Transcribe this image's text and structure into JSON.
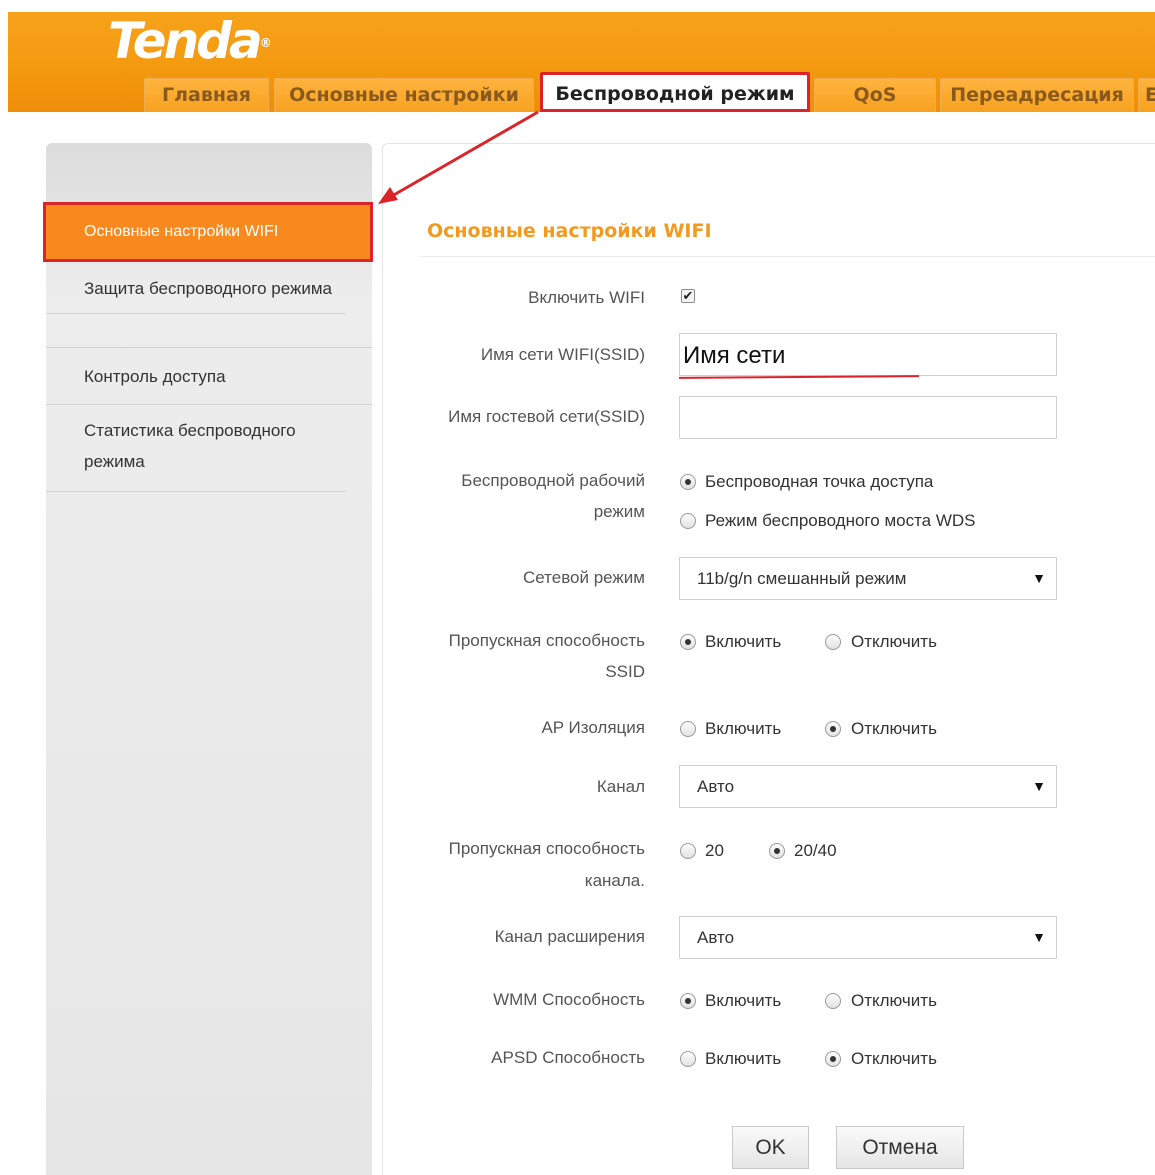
{
  "brand": {
    "logo_text": "Tenda",
    "logo_mark": "®"
  },
  "tabs": [
    {
      "label": "Главная"
    },
    {
      "label": "Основные настройки"
    },
    {
      "label": "Беспроводной режим"
    },
    {
      "label": "QoS"
    },
    {
      "label": "Переадресация"
    },
    {
      "label": "Е"
    }
  ],
  "sidebar": {
    "items": [
      {
        "label": "Основные настройки WIFI"
      },
      {
        "label": "Защита беспроводного режима"
      },
      {
        "label": "Контроль доступа"
      },
      {
        "label": "Статистика беспроводного режима"
      }
    ]
  },
  "main": {
    "title": "Основные настройки WIFI",
    "enable_wifi": {
      "label": "Включить WIFI",
      "checked": true,
      "mark": "✔"
    },
    "ssid": {
      "label": "Имя сети WIFI(SSID)",
      "value": "Имя сети"
    },
    "guest_ssid": {
      "label": "Имя гостевой сети(SSID)",
      "value": ""
    },
    "wireless_mode": {
      "label_line1": "Беспроводной рабочий",
      "label_line2": "режим",
      "options": [
        "Беспроводная точка доступа",
        "Режим беспроводного моста WDS"
      ],
      "selected": 0
    },
    "network_mode": {
      "label": "Сетевой режим",
      "value": "11b/g/n смешанный режим"
    },
    "ssid_broadcast": {
      "label_line1": "Пропускная способность",
      "label_line2": "SSID",
      "options": [
        "Включить",
        "Отключить"
      ],
      "selected": 0
    },
    "ap_isolation": {
      "label": "AP Изоляция",
      "options": [
        "Включить",
        "Отключить"
      ],
      "selected": 1
    },
    "channel": {
      "label": "Канал",
      "value": "Авто"
    },
    "channel_bandwidth": {
      "label_line1": "Пропускная способность",
      "label_line2": "канала.",
      "options": [
        "20",
        "20/40"
      ],
      "selected": 1
    },
    "extension_channel": {
      "label": "Канал расширения",
      "value": "Авто"
    },
    "wmm": {
      "label": "WMM Способность",
      "options": [
        "Включить",
        "Отключить"
      ],
      "selected": 0
    },
    "apsd": {
      "label": "APSD Способность",
      "options": [
        "Включить",
        "Отключить"
      ],
      "selected": 1
    },
    "buttons": {
      "ok": "OK",
      "cancel": "Отмена"
    },
    "dropdown_arrow": "▼"
  },
  "colors": {
    "header_orange": "#f39a10",
    "active_menu": "#f7891f",
    "title_orange": "#f29a1f",
    "annotation_red": "#d9252a"
  }
}
